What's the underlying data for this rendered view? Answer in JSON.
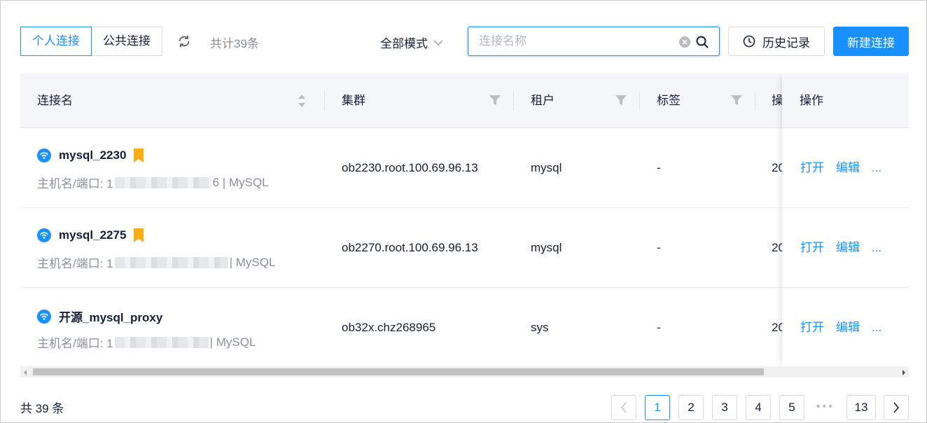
{
  "tabs": [
    {
      "label": "个人连接",
      "active": true
    },
    {
      "label": "公共连接",
      "active": false
    }
  ],
  "toolbar": {
    "total_label": "共计39条",
    "mode_label": "全部模式",
    "search_placeholder": "连接名称",
    "history_label": "历史记录",
    "new_label": "新建连接"
  },
  "table": {
    "columns": {
      "name": "连接名",
      "cluster": "集群",
      "tenant": "租户",
      "tags": "标签",
      "clipped": "操",
      "actions": "操作"
    },
    "rows": [
      {
        "name": "mysql_2230",
        "host_prefix": "主机名/端口: 1",
        "host_suffix": "6 | MySQL",
        "cluster": "ob2230.root.100.69.96.13",
        "tenant": "mysql",
        "tags": "-",
        "clipped": "20",
        "bookmarked": true
      },
      {
        "name": "mysql_2275",
        "host_prefix": "主机名/端口: 1",
        "host_suffix": "| MySQL",
        "cluster": "ob2270.root.100.69.96.13",
        "tenant": "mysql",
        "tags": "-",
        "clipped": "20",
        "bookmarked": true
      },
      {
        "name": "开源_mysql_proxy",
        "host_prefix": "主机名/端口: 1",
        "host_suffix": "| MySQL",
        "cluster": "ob32x.chz268965",
        "tenant": "sys",
        "tags": "-",
        "clipped": "20",
        "bookmarked": false
      }
    ],
    "actions": {
      "open": "打开",
      "edit": "编辑",
      "more": "..."
    }
  },
  "footer": {
    "total_label": "共 39 条",
    "pages": [
      "1",
      "2",
      "3",
      "4",
      "5"
    ],
    "last_page": "13",
    "current_page": "1",
    "ellipsis": "•••"
  },
  "colors": {
    "accent": "#1890ff",
    "bookmark": "#faad14",
    "status_icon": "#1890ff"
  }
}
